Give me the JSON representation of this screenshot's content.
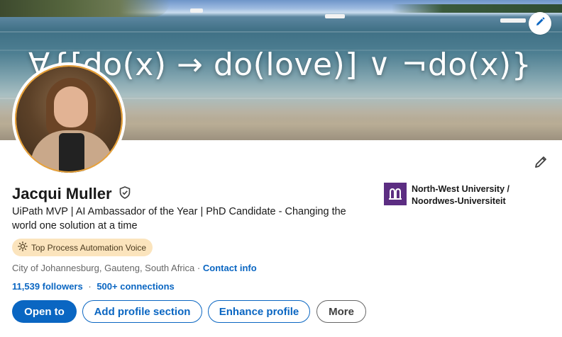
{
  "banner": {
    "formula_text": "∀{[do(x) → do(love)] ∨ ¬do(x)}",
    "edit_icon": "pencil-icon"
  },
  "profile": {
    "name": "Jacqui Muller",
    "verified_icon": "verified-shield-icon",
    "headline": "UiPath MVP | AI Ambassador of the Year | PhD Candidate - Changing the world one solution at a time",
    "badge_label": "Top Process Automation Voice",
    "badge_icon": "sun-icon",
    "location": "City of Johannesburg, Gauteng, South Africa",
    "location_separator": "·",
    "contact_info_label": "Contact info",
    "followers": "11,539 followers",
    "stats_separator": "·",
    "connections": "500+ connections",
    "edit_icon": "pencil-icon"
  },
  "education": {
    "line1": "North-West University /",
    "line2": "Noordwes-Universiteit"
  },
  "actions": {
    "open_to": "Open to",
    "add_section": "Add profile section",
    "enhance": "Enhance profile",
    "more": "More"
  },
  "colors": {
    "primary": "#0a66c2",
    "badge_bg": "#fbe4bd",
    "university": "#5c2d82",
    "avatar_ring": "#e8a23a"
  }
}
